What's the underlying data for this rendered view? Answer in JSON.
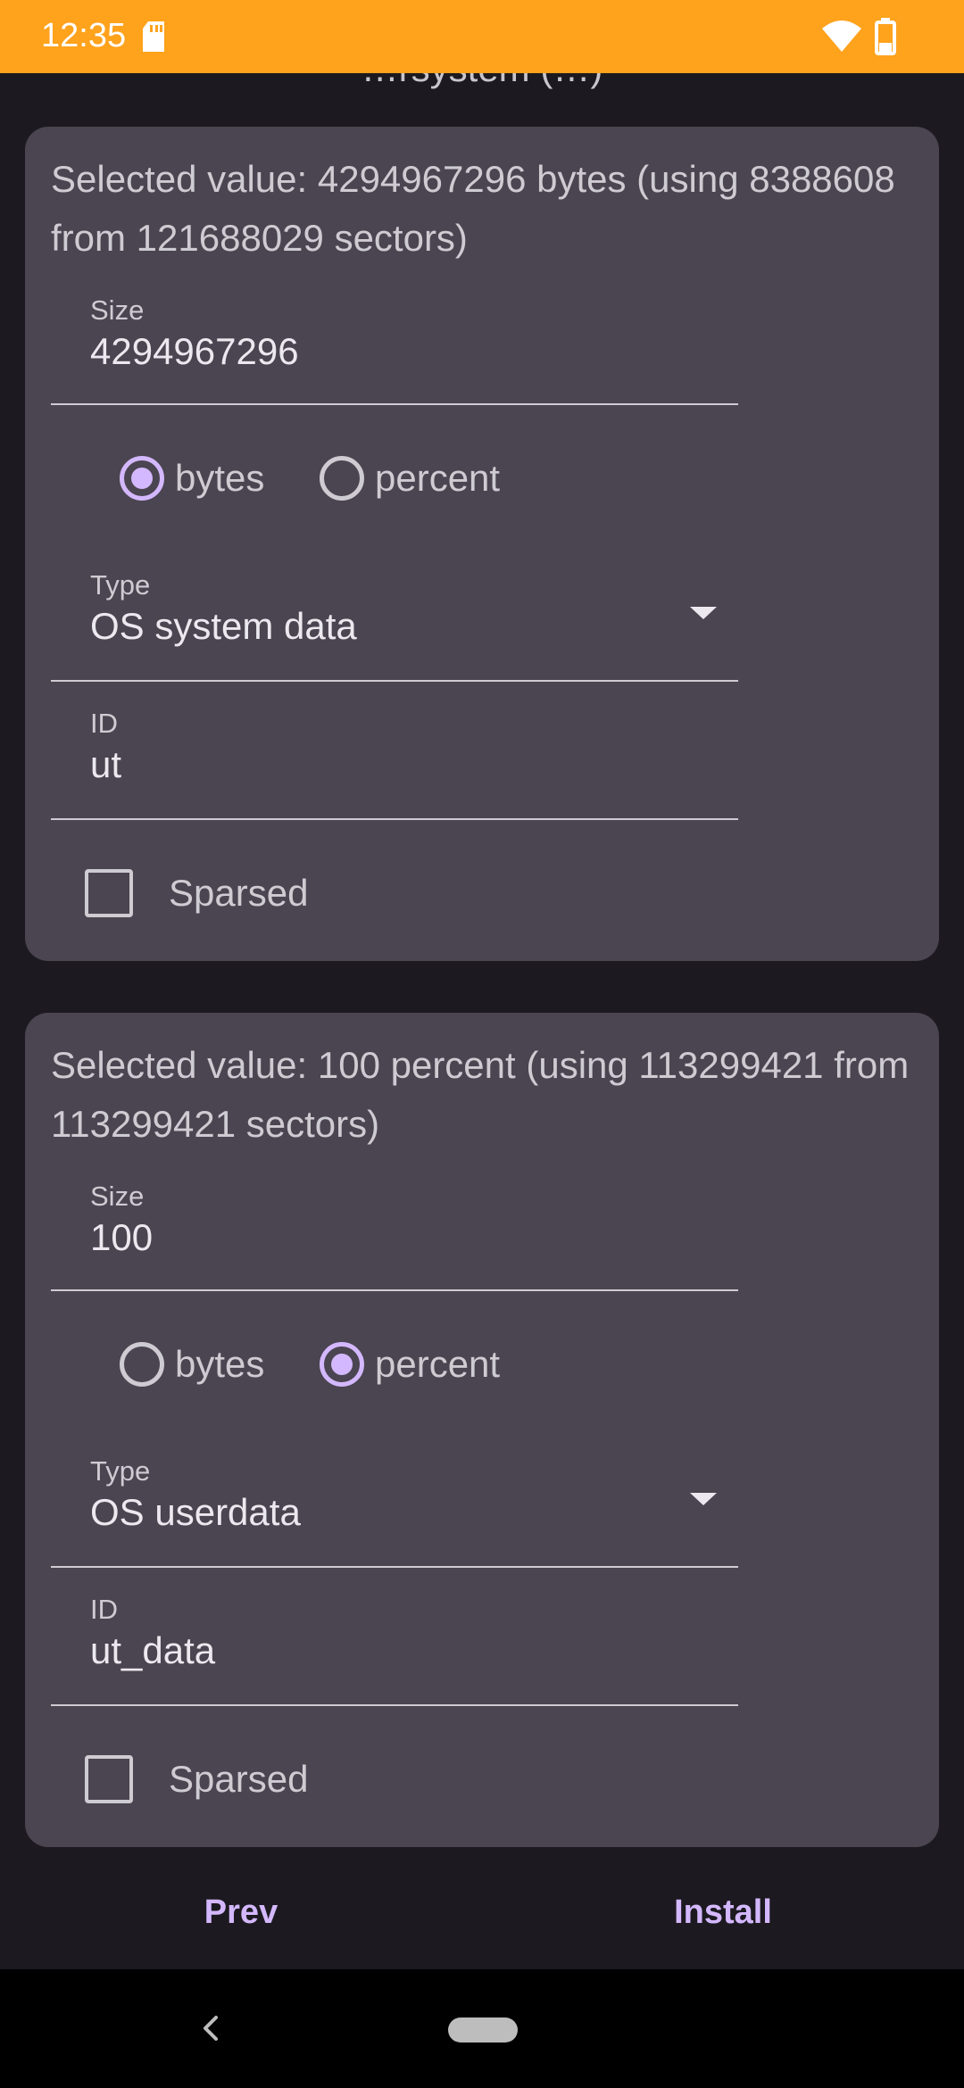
{
  "status_bar": {
    "time": "12:35",
    "background_color": "#ffa21c",
    "icons": [
      "sd-card-icon",
      "wifi-icon",
      "battery-icon"
    ]
  },
  "header": {
    "clipped_title": "…rsystem (…)"
  },
  "partitions": [
    {
      "summary": "Selected value: 4294967296 bytes (using 8388608 from 121688029 sectors)",
      "size": {
        "label": "Size",
        "value": "4294967296"
      },
      "unit_options": [
        {
          "label": "bytes",
          "selected": true
        },
        {
          "label": "percent",
          "selected": false
        }
      ],
      "type": {
        "label": "Type",
        "value": "OS system data"
      },
      "id": {
        "label": "ID",
        "value": "ut"
      },
      "sparsed": {
        "label": "Sparsed",
        "checked": false
      }
    },
    {
      "summary": "Selected value: 100 percent (using 113299421 from 113299421 sectors)",
      "size": {
        "label": "Size",
        "value": "100"
      },
      "unit_options": [
        {
          "label": "bytes",
          "selected": false
        },
        {
          "label": "percent",
          "selected": true
        }
      ],
      "type": {
        "label": "Type",
        "value": "OS userdata"
      },
      "id": {
        "label": "ID",
        "value": "ut_data"
      },
      "sparsed": {
        "label": "Sparsed",
        "checked": false
      }
    }
  ],
  "footer": {
    "prev_label": "Prev",
    "install_label": "Install"
  },
  "theme": {
    "accent": "#d4b8ff",
    "card_bg": "#4a4550",
    "page_bg": "#1c1a20"
  }
}
